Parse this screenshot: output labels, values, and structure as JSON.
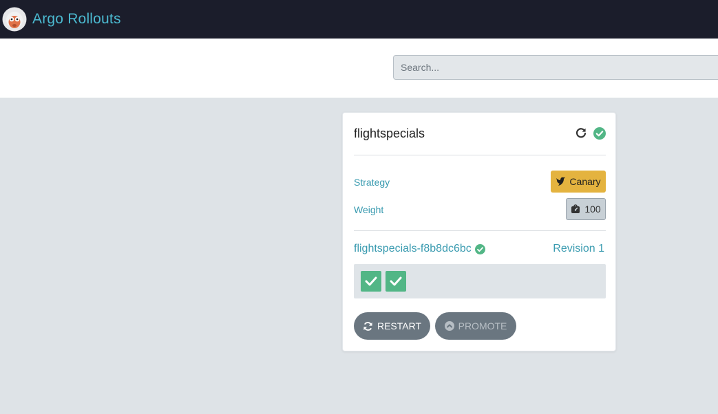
{
  "header": {
    "title": "Argo Rollouts",
    "logo_icon": "argo-mascot-icon"
  },
  "filter": {
    "search_placeholder": "Search..."
  },
  "rollout": {
    "name": "flightspecials",
    "status": "healthy",
    "strategy_label": "Strategy",
    "strategy_value": "Canary",
    "weight_label": "Weight",
    "weight_value": "100",
    "replicaset_name": "flightspecials-f8b8dc6bc",
    "revision": "Revision 1",
    "pods": [
      {
        "status": "running"
      },
      {
        "status": "running"
      }
    ],
    "restart_label": "RESTART",
    "promote_label": "PROMOTE"
  },
  "colors": {
    "topbar": "#1b1d2b",
    "brand": "#4bb9d0",
    "healthy": "#52b686",
    "canary": "#e4b33f",
    "button": "#6a7680"
  }
}
